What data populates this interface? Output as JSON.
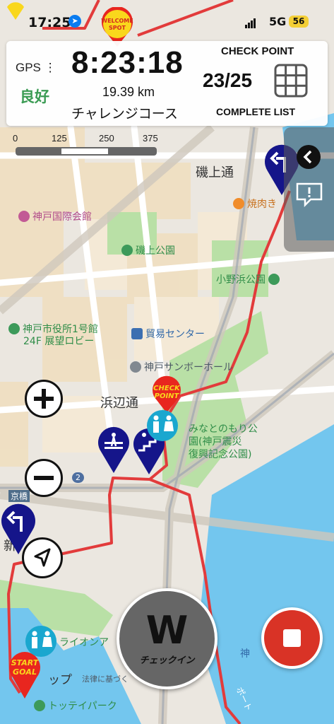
{
  "status_bar": {
    "time": "17:25",
    "network": "5G",
    "battery": "56"
  },
  "panel": {
    "gps_label": "GPS ⋮",
    "gps_status": "良好",
    "elapsed": "8:23:18",
    "distance": "19.39 km",
    "course": "チャレンジコース",
    "checkpoint_label": "CHECK POINT",
    "checkpoint_count": "23/25",
    "complete_list": "COMPLETE LIST"
  },
  "scale": {
    "ticks": [
      "0",
      "125",
      "250",
      "375 m"
    ]
  },
  "map_labels": {
    "isogami_dori": "磯上通",
    "yakiniku": "焼肉き",
    "kobe_kokusai": "神戸国際会館",
    "isogami_park": "磯上公園",
    "onohama_park": "小野浜公園",
    "city_hall": "神戸市役所1号館",
    "city_hall_2": "24F 展望ロビー",
    "trade_center": "貿易センター",
    "sunbo_hall": "神戸サンボーホール",
    "hamabe_dori": "浜辺通",
    "minato_park_1": "みなとのもり公",
    "minato_park_2": "園(神戸震災",
    "minato_park_3": "復興記念公園)",
    "lion": "ライオンア",
    "map_text": "ップ",
    "law": "法律に基づく",
    "tottei": "トッテイパーク",
    "kyobashi": "京橋",
    "shin": "新",
    "kobe": "神",
    "road_2": "2",
    "hourou": "ポート"
  },
  "pins": {
    "check_point_line1": "CHECK",
    "check_point_line2": "POINT",
    "welcome_line1": "WELCOME",
    "welcome_line2": "SPOT",
    "start_line1": "START",
    "start_line2": "GOAL"
  },
  "checkin": {
    "logo": "W",
    "label": "チェックイン"
  },
  "colors": {
    "route": "#e23b3b",
    "water": "#73c6ee",
    "park": "#b9e0a6",
    "pin_navy": "#15158a",
    "gps_good": "#3a9b53"
  }
}
